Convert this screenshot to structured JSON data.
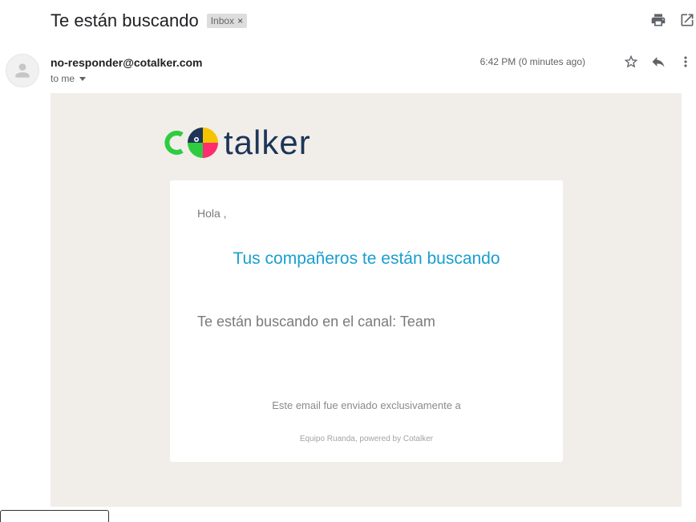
{
  "header": {
    "subject": "Te están buscando",
    "label": "Inbox",
    "label_remove": "×"
  },
  "icons": {
    "print": "print-icon",
    "open_new_window": "open-in-new-window-icon",
    "star": "star-icon",
    "reply": "reply-icon",
    "more": "more-vertical-icon",
    "avatar": "avatar-icon"
  },
  "message": {
    "sender": "no-responder@cotalker.com",
    "recipient": "to me",
    "timestamp": "6:42 PM (0 minutes ago)"
  },
  "email": {
    "logo_text": "talker",
    "logo_brand": "cotalker",
    "greeting": "Hola ,",
    "headline": "Tus compañeros te están buscando",
    "channel_line": "Te están buscando en el canal: Team",
    "footer_note": "Este email fue enviado exclusivamente a",
    "powered_by": "Equipo Ruanda, powered by Cotalker"
  },
  "colors": {
    "email_background": "#f1eeea",
    "headline": "#199ed0",
    "logo_text": "#1d3557",
    "logo_green": "#2ecc40",
    "logo_yellow": "#f5c400",
    "logo_pink": "#ff2d6f",
    "logo_navy": "#1d3557"
  }
}
